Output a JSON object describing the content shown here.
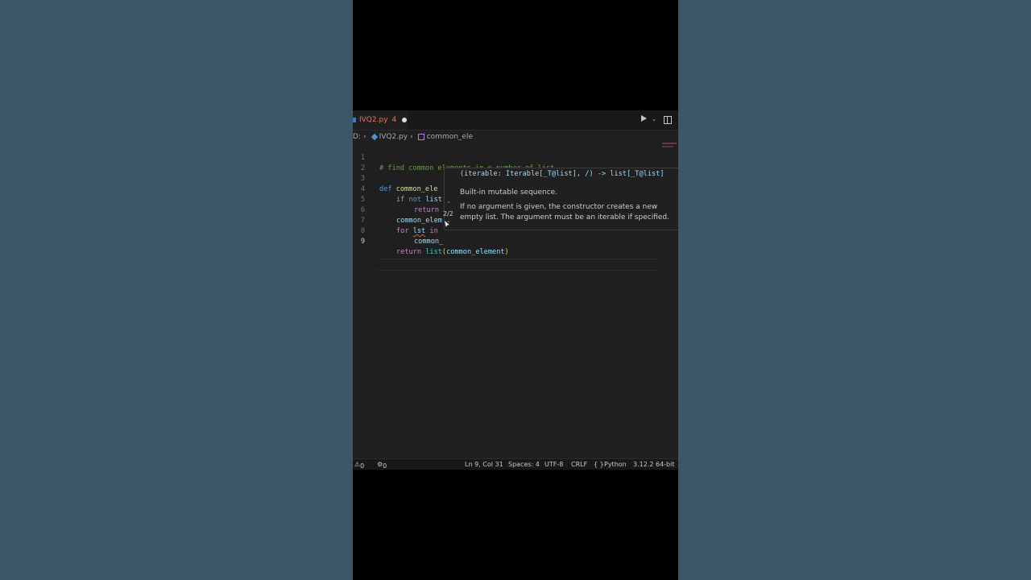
{
  "tab": {
    "filename": "IVQ2.py",
    "problems_badge": "4"
  },
  "breadcrumb": {
    "prefix": "D:",
    "file": "IVQ2.py",
    "symbol": "common_ele"
  },
  "code": {
    "lines": [
      {
        "num": "1"
      },
      {
        "num": "2"
      },
      {
        "num": "3"
      },
      {
        "num": "4"
      },
      {
        "num": "5"
      },
      {
        "num": "6"
      },
      {
        "num": "7"
      },
      {
        "num": "8"
      },
      {
        "num": "9"
      }
    ],
    "l1_comment": "# find common elements in n number of list",
    "l3_def": "def ",
    "l3_name": "common_ele",
    "l4_if": "if ",
    "l4_not": "not ",
    "l4_var": "list",
    "l5_return": "return",
    "l6_var": "common_elem",
    "l7_for": "for ",
    "l7_lst": "lst",
    "l7_in": " in",
    "l8_var": "common_",
    "l9_return": "return ",
    "l9_list": "list",
    "l9_open": "(",
    "l9_arg": "common_element",
    "l9_close": ")"
  },
  "hover": {
    "signature": "(iterable: Iterable[_T@list], /) -> list[_T@list]",
    "description": "Built-in mutable sequence.",
    "details": "If no argument is given, the constructor creates a new empty list. The argument must be an iterable if specified.",
    "counter": "2/2"
  },
  "status": {
    "errors": "0",
    "warnings": "0",
    "position": "Ln 9, Col 31",
    "spaces": "Spaces: 4",
    "encoding": "UTF-8",
    "eol": "CRLF",
    "language_braces": "{ }",
    "language": "Python",
    "interpreter": "3.12.2 64-bit"
  }
}
